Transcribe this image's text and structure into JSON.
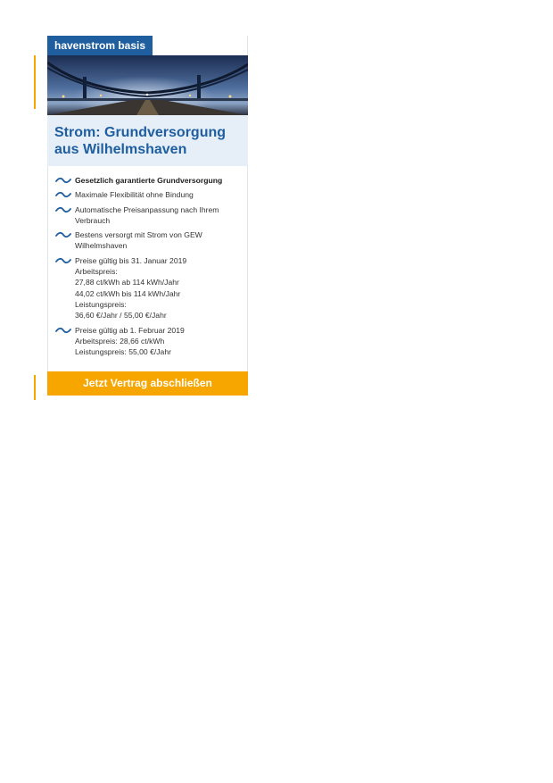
{
  "card": {
    "tag": "havenstrom basis",
    "title_line1": "Strom: Grundversorgung",
    "title_line2": "aus Wilhelmshaven",
    "items": [
      {
        "lines": [
          "Gesetzlich garantierte Grundversorgung"
        ]
      },
      {
        "lines": [
          "Maximale Flexibilität ohne Bindung"
        ]
      },
      {
        "lines": [
          "Automatische Preisanpassung nach Ihrem",
          "Verbrauch"
        ]
      },
      {
        "lines": [
          "Bestens versorgt mit Strom von GEW",
          "Wilhelmshaven"
        ]
      },
      {
        "lines": [
          "Preise gültig bis 31. Januar 2019",
          "Arbeitspreis:",
          "27,88 ct/kWh ab 114 kWh/Jahr",
          "44,02 ct/kWh bis 114 kWh/Jahr",
          "Leistungspreis:",
          "36,60 €/Jahr / 55,00 €/Jahr"
        ]
      },
      {
        "lines": [
          "Preise gültig ab 1. Februar 2019",
          "Arbeitspreis: 28,66 ct/kWh",
          "Leistungspreis: 55,00 €/Jahr"
        ]
      }
    ],
    "bullet_icon": "wave-icon",
    "cta_label": "Jetzt Vertrag abschließen"
  },
  "colors": {
    "brand_blue": "#1f5fa0",
    "accent_orange": "#f7a600",
    "title_band": "#e6eef7"
  }
}
